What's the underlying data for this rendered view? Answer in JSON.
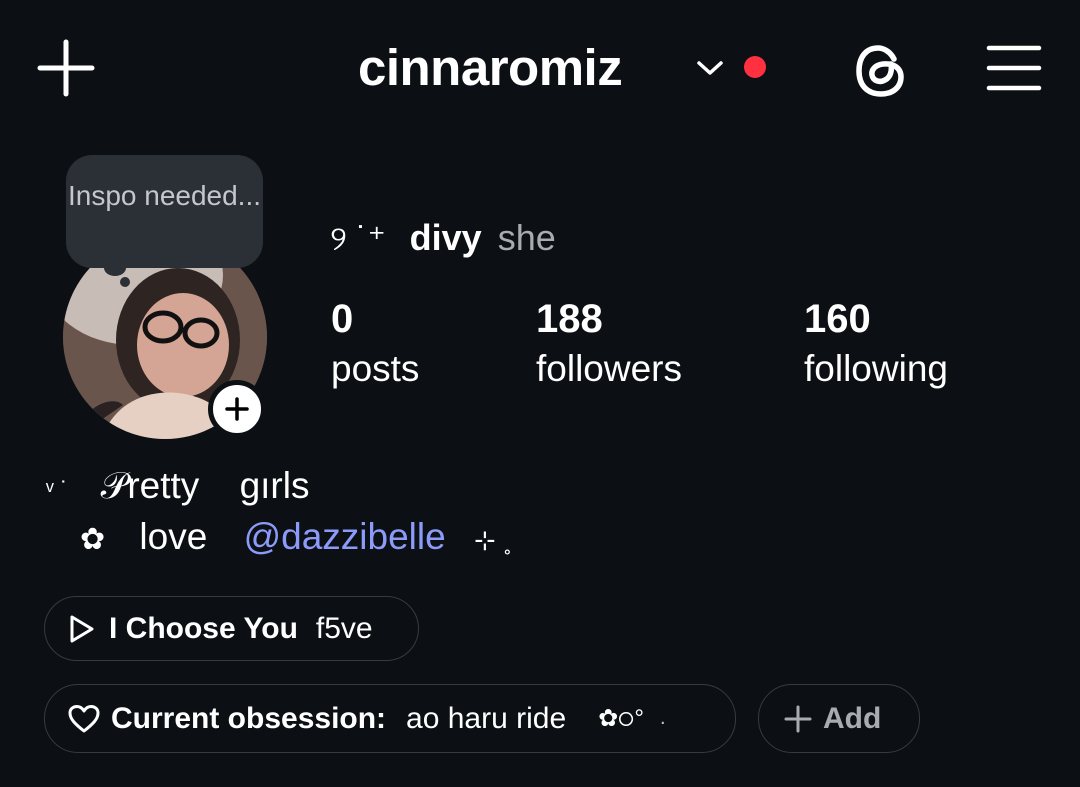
{
  "header": {
    "username": "cinnaromiz",
    "icons": [
      "plus-icon",
      "chevron-down-icon",
      "threads-icon",
      "menu-icon"
    ],
    "notification_dot_color": "#ff3040"
  },
  "note": {
    "text": "Inspo needed..."
  },
  "profile": {
    "name_deco": "୨ ˙⁺",
    "display_name": "divy",
    "pronouns": "she"
  },
  "stats": [
    {
      "value": "0",
      "label": "posts"
    },
    {
      "value": "188",
      "label": "followers"
    },
    {
      "value": "160",
      "label": "following"
    }
  ],
  "bio": {
    "line1_deco": "ᵛ ˙",
    "line1_word1": "𝒫retty",
    "line1_word2": "gırls",
    "line2_flower": "✿",
    "line2_word": "love",
    "line2_mention": "@dazzibelle",
    "line2_deco": "⊹ ˳"
  },
  "music": {
    "title": "I Choose You",
    "artist": "f5ve"
  },
  "obsession": {
    "label": "Current obsession:",
    "value": "ao haru ride",
    "deco": "✿੦°",
    "deco2": "."
  },
  "add_button": {
    "label": "Add"
  },
  "colors": {
    "background": "#0c1014",
    "mention": "#8c9bfa",
    "pill_border": "#363b42",
    "note_bg": "#2b3036"
  }
}
